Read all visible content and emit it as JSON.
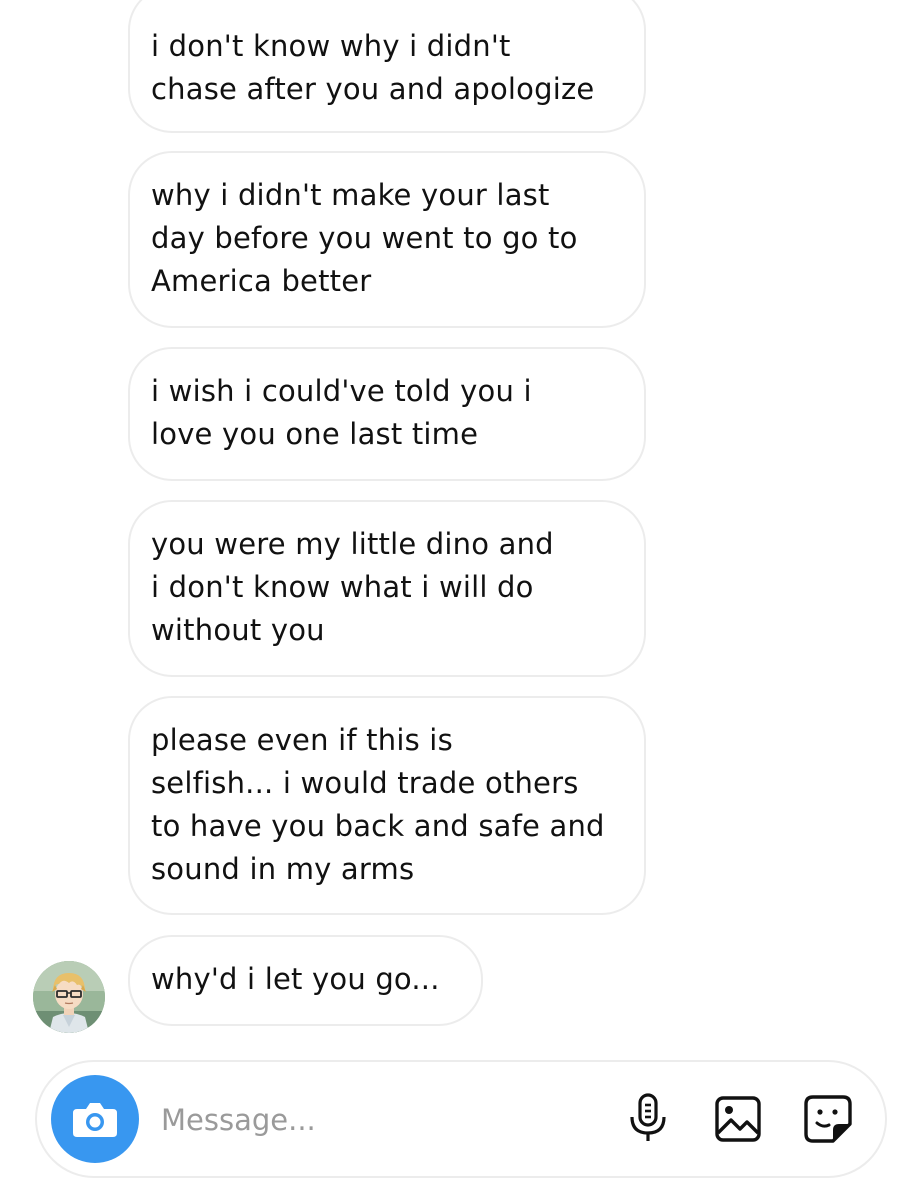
{
  "messages": [
    {
      "lines": [
        "i don't know why i didn't",
        "chase after you and apologize"
      ]
    },
    {
      "lines": [
        "why i didn't make your last",
        "day before you went to go to",
        "America better"
      ]
    },
    {
      "lines": [
        "i wish i could've told you i",
        "love you one last time"
      ]
    },
    {
      "lines": [
        "you were my little dino and",
        "i don't know what i will do",
        "without you"
      ]
    },
    {
      "lines": [
        "please even if this is",
        "selfish... i would trade others",
        "to have you back and safe and",
        "sound in my arms"
      ]
    },
    {
      "lines": [
        "why'd i let you go..."
      ]
    }
  ],
  "composer": {
    "placeholder": "Message...",
    "camera_icon": "camera-icon",
    "mic_icon": "microphone-icon",
    "gallery_icon": "image-gallery-icon",
    "sticker_icon": "sticker-icon",
    "accent": "#3897f0"
  },
  "avatar": {
    "icon": "sender-avatar"
  }
}
